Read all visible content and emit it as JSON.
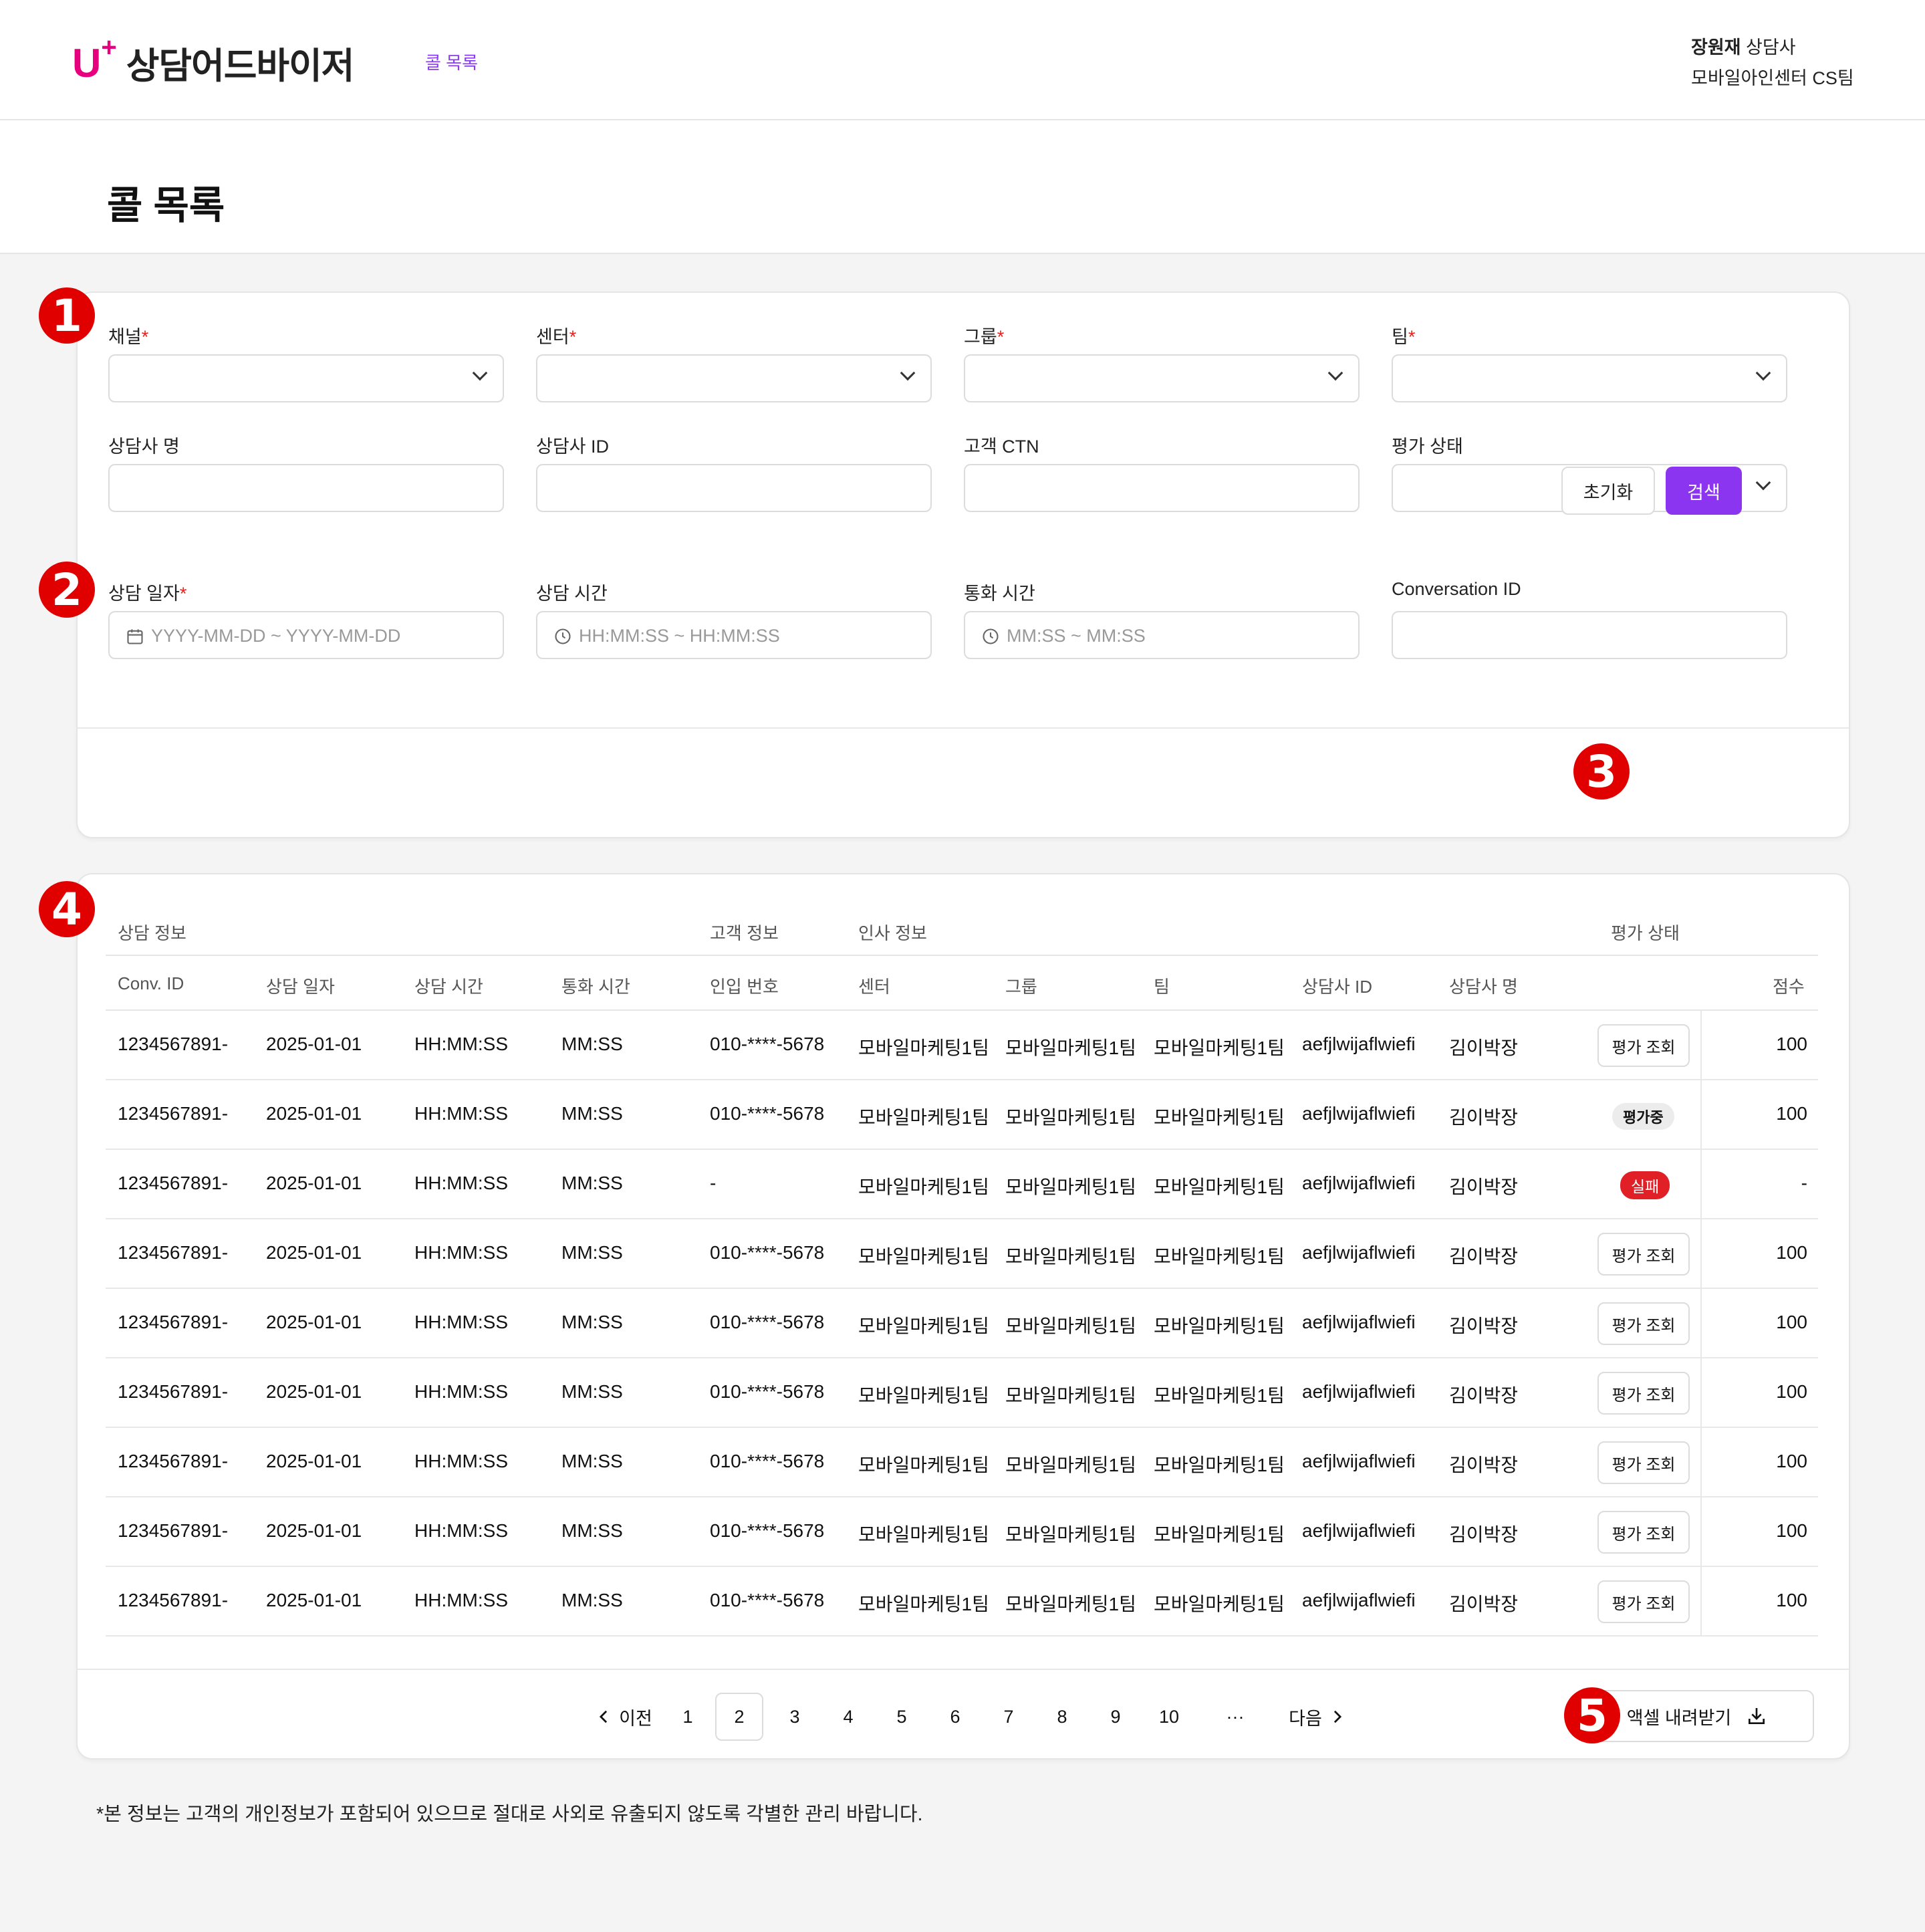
{
  "header": {
    "logo_mark": "U",
    "logo_text": "상담어드바이저",
    "nav_link": "콜 목록",
    "user_name": "장원재",
    "user_role": "상담사",
    "user_team": "모바일아인센터 CS팀"
  },
  "page_title": "콜 목록",
  "markers": [
    "1",
    "2",
    "3",
    "4",
    "5"
  ],
  "filters": {
    "channel": "채널",
    "center": "센터",
    "group": "그룹",
    "team": "팀",
    "agent_name": "상담사 명",
    "agent_id": "상담사 ID",
    "customer_ctn": "고객 CTN",
    "eval_status": "평가 상태",
    "consult_date": "상담 일자",
    "consult_time": "상담 시간",
    "call_time": "통화 시간",
    "conversation_id": "Conversation ID",
    "required_mark": "*",
    "date_placeholder": "YYYY-MM-DD ~ YYYY-MM-DD",
    "time_placeholder": "HH:MM:SS ~ HH:MM:SS",
    "call_placeholder": "MM:SS ~ MM:SS",
    "reset_label": "초기화",
    "search_label": "검색"
  },
  "table": {
    "groups": [
      "상담 정보",
      "고객 정보",
      "인사 정보",
      "평가 상태"
    ],
    "columns": [
      "Conv. ID",
      "상담 일자",
      "상담 시간",
      "통화 시간",
      "인입 번호",
      "센터",
      "그룹",
      "팀",
      "상담사 ID",
      "상담사 명",
      "점수"
    ],
    "rows": [
      {
        "conv": "1234567891-",
        "date": "2025-01-01",
        "time": "HH:MM:SS",
        "call": "MM:SS",
        "num": "010-****-5678",
        "center": "모바일마케팅1팀",
        "group": "모바일마케팅1팀",
        "team": "모바일마케팅1팀",
        "agent_id": "aefjlwijaflwiefi",
        "agent": "김이박장",
        "status": "평가 조회",
        "score": "100"
      },
      {
        "conv": "1234567891-",
        "date": "2025-01-01",
        "time": "HH:MM:SS",
        "call": "MM:SS",
        "num": "010-****-5678",
        "center": "모바일마케팅1팀",
        "group": "모바일마케팅1팀",
        "team": "모바일마케팅1팀",
        "agent_id": "aefjlwijaflwiefi",
        "agent": "김이박장",
        "status": "평가중",
        "score": "100"
      },
      {
        "conv": "1234567891-",
        "date": "2025-01-01",
        "time": "HH:MM:SS",
        "call": "MM:SS",
        "num": "-",
        "center": "모바일마케팅1팀",
        "group": "모바일마케팅1팀",
        "team": "모바일마케팅1팀",
        "agent_id": "aefjlwijaflwiefi",
        "agent": "김이박장",
        "status": "실패",
        "score": "-"
      },
      {
        "conv": "1234567891-",
        "date": "2025-01-01",
        "time": "HH:MM:SS",
        "call": "MM:SS",
        "num": "010-****-5678",
        "center": "모바일마케팅1팀",
        "group": "모바일마케팅1팀",
        "team": "모바일마케팅1팀",
        "agent_id": "aefjlwijaflwiefi",
        "agent": "김이박장",
        "status": "평가 조회",
        "score": "100"
      },
      {
        "conv": "1234567891-",
        "date": "2025-01-01",
        "time": "HH:MM:SS",
        "call": "MM:SS",
        "num": "010-****-5678",
        "center": "모바일마케팅1팀",
        "group": "모바일마케팅1팀",
        "team": "모바일마케팅1팀",
        "agent_id": "aefjlwijaflwiefi",
        "agent": "김이박장",
        "status": "평가 조회",
        "score": "100"
      },
      {
        "conv": "1234567891-",
        "date": "2025-01-01",
        "time": "HH:MM:SS",
        "call": "MM:SS",
        "num": "010-****-5678",
        "center": "모바일마케팅1팀",
        "group": "모바일마케팅1팀",
        "team": "모바일마케팅1팀",
        "agent_id": "aefjlwijaflwiefi",
        "agent": "김이박장",
        "status": "평가 조회",
        "score": "100"
      },
      {
        "conv": "1234567891-",
        "date": "2025-01-01",
        "time": "HH:MM:SS",
        "call": "MM:SS",
        "num": "010-****-5678",
        "center": "모바일마케팅1팀",
        "group": "모바일마케팅1팀",
        "team": "모바일마케팅1팀",
        "agent_id": "aefjlwijaflwiefi",
        "agent": "김이박장",
        "status": "평가 조회",
        "score": "100"
      },
      {
        "conv": "1234567891-",
        "date": "2025-01-01",
        "time": "HH:MM:SS",
        "call": "MM:SS",
        "num": "010-****-5678",
        "center": "모바일마케팅1팀",
        "group": "모바일마케팅1팀",
        "team": "모바일마케팅1팀",
        "agent_id": "aefjlwijaflwiefi",
        "agent": "김이박장",
        "status": "평가 조회",
        "score": "100"
      },
      {
        "conv": "1234567891-",
        "date": "2025-01-01",
        "time": "HH:MM:SS",
        "call": "MM:SS",
        "num": "010-****-5678",
        "center": "모바일마케팅1팀",
        "group": "모바일마케팅1팀",
        "team": "모바일마케팅1팀",
        "agent_id": "aefjlwijaflwiefi",
        "agent": "김이박장",
        "status": "평가 조회",
        "score": "100"
      }
    ]
  },
  "pagination": {
    "prev": "이전",
    "next": "다음",
    "pages": [
      "1",
      "2",
      "3",
      "4",
      "5",
      "6",
      "7",
      "8",
      "9",
      "10"
    ],
    "current": "2",
    "ellipsis": "···"
  },
  "excel_label": "액셀 내려받기",
  "footnote": "*본 정보는 고객의 개인정보가 포함되어 있으므로 절대로 사외로 유출되지 않도록 각별한 관리 바랍니다.",
  "colors": {
    "brand": "#e6007e",
    "accent": "#8b35f0",
    "danger": "#e01f26",
    "marker": "#e10000"
  }
}
